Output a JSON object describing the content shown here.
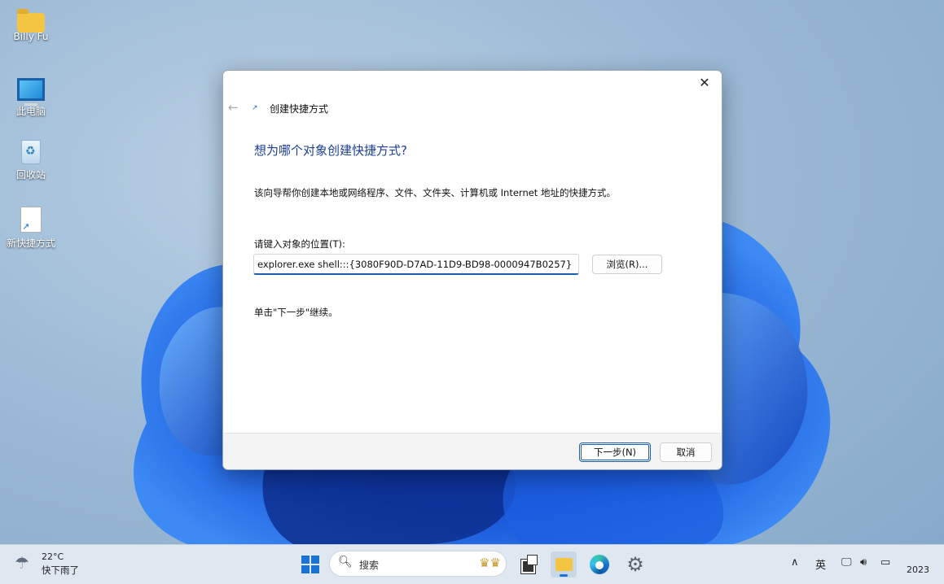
{
  "desktop": {
    "icons": [
      {
        "label": "Billy Fu",
        "icon": "folder-icon"
      },
      {
        "label": "此电脑",
        "icon": "computer-icon"
      },
      {
        "label": "回收站",
        "icon": "recycle-bin-icon"
      },
      {
        "label": "新快捷方式",
        "icon": "shortcut-file-icon"
      }
    ]
  },
  "dialog": {
    "title": "创建快捷方式",
    "close_glyph": "✕",
    "back_glyph": "←",
    "heading": "想为哪个对象创建快捷方式?",
    "description": "该向导帮你创建本地或网络程序、文件、文件夹、计算机或 Internet 地址的快捷方式。",
    "location_label": "请键入对象的位置(T):",
    "location_value": "explorer.exe shell:::{3080F90D-D7AD-11D9-BD98-0000947B0257}",
    "browse_label": "浏览(R)...",
    "hint": "单击\"下一步\"继续。",
    "next_label": "下一步(N)",
    "cancel_label": "取消"
  },
  "taskbar": {
    "weather_temp": "22°C",
    "weather_condition": "快下雨了",
    "search_placeholder": "搜索",
    "tray_chevron": "∧",
    "ime": "英",
    "clock_year": "2023"
  },
  "colors": {
    "accent": "#1c5fb0",
    "heading": "#1c3f94",
    "taskbar": "#dfe7f0"
  }
}
